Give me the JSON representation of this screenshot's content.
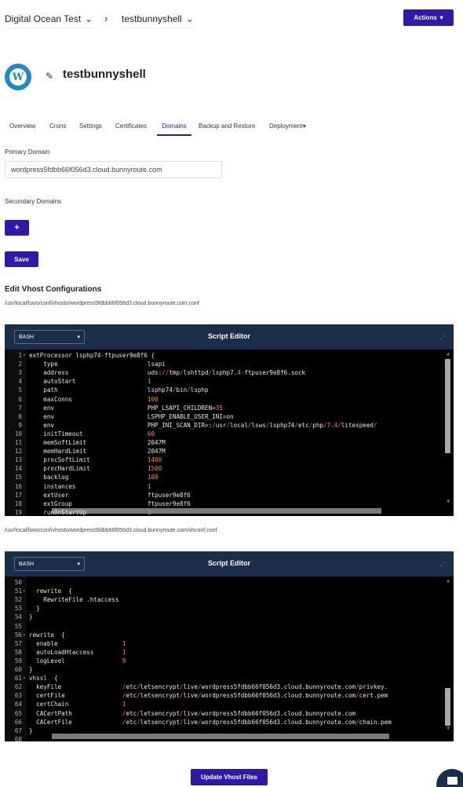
{
  "topbar": {
    "project": "Digital Ocean Test",
    "environment": "testbunnyshell",
    "separator": "›",
    "actions_label": "Actions"
  },
  "header": {
    "site_name": "testbunnyshell",
    "logo_letter": "W"
  },
  "tabs": [
    "Overview",
    "Crons",
    "Settings",
    "Certificates",
    "Domains",
    "Backup and Restore",
    "Deployment"
  ],
  "active_tab": "Domains",
  "domains": {
    "primary_label": "Primary Domain",
    "primary_value": "wordpress5fdbb66f056d3.cloud.bunnyroute.com",
    "secondary_label": "Secondary Domains",
    "add_label": "+",
    "save_label": "Save"
  },
  "vhost": {
    "title": "Edit Vhost Configurations",
    "path1": "/usr/local/lsws/conf/vhosts/wordpress5fdbb66f056d3.cloud.bunnyroute.com.conf",
    "path2": "/usr/local/lsws/conf/vhosts/wordpress5fdbb66f056d3.cloud.bunnyroute.com/vhconf.conf",
    "update_label": "Update Vhost Files"
  },
  "editor1": {
    "language": "BASH",
    "title": "Script Editor",
    "lines": [
      {
        "n": "1",
        "fold": true,
        "parts": [
          [
            "t",
            "extProcessor lsphp74-ftpuser9e8f6 {"
          ]
        ]
      },
      {
        "n": "2",
        "parts": [
          [
            "t",
            "    type                         lsapi"
          ]
        ]
      },
      {
        "n": "3",
        "parts": [
          [
            "t",
            "    address                      uds:"
          ],
          [
            "s",
            "//"
          ],
          [
            "t",
            "tmp"
          ],
          [
            "s",
            "/"
          ],
          [
            "t",
            "lshttpd"
          ],
          [
            "s",
            "/"
          ],
          [
            "t",
            "lsphp7."
          ],
          [
            "n",
            "4"
          ],
          [
            "s",
            "-"
          ],
          [
            "t",
            "ftpuser9e8f6.sock"
          ]
        ]
      },
      {
        "n": "4",
        "parts": [
          [
            "t",
            "    autoStart                    "
          ],
          [
            "n",
            "1"
          ]
        ]
      },
      {
        "n": "5",
        "parts": [
          [
            "t",
            "    path                         lsphp74"
          ],
          [
            "s",
            "/"
          ],
          [
            "t",
            "bin"
          ],
          [
            "s",
            "/"
          ],
          [
            "t",
            "lsphp"
          ]
        ]
      },
      {
        "n": "6",
        "parts": [
          [
            "t",
            "    maxConns                     "
          ],
          [
            "n",
            "100"
          ]
        ]
      },
      {
        "n": "7",
        "parts": [
          [
            "t",
            "    env                          PHP_LSAPI_CHILDREN="
          ],
          [
            "n",
            "35"
          ]
        ]
      },
      {
        "n": "8",
        "parts": [
          [
            "t",
            "    env                          LSPHP_ENABLE_USER_INI=on"
          ]
        ]
      },
      {
        "n": "9",
        "parts": [
          [
            "t",
            "    env                          PHP_INI_SCAN_DIR=:"
          ],
          [
            "s",
            "/"
          ],
          [
            "t",
            "usr"
          ],
          [
            "s",
            "/"
          ],
          [
            "t",
            "local"
          ],
          [
            "s",
            "/"
          ],
          [
            "t",
            "lsws"
          ],
          [
            "s",
            "/"
          ],
          [
            "t",
            "lsphp74"
          ],
          [
            "s",
            "/"
          ],
          [
            "t",
            "etc"
          ],
          [
            "s",
            "/"
          ],
          [
            "t",
            "php"
          ],
          [
            "s",
            "/"
          ],
          [
            "n",
            "7.4"
          ],
          [
            "s",
            "/"
          ],
          [
            "t",
            "litespeed"
          ],
          [
            "s",
            "/"
          ]
        ]
      },
      {
        "n": "10",
        "parts": [
          [
            "t",
            "    initTimeout                  "
          ],
          [
            "n",
            "60"
          ]
        ]
      },
      {
        "n": "11",
        "parts": [
          [
            "t",
            "    memSoftLimit                 2047M"
          ]
        ]
      },
      {
        "n": "12",
        "parts": [
          [
            "t",
            "    memHardLimit                 2047M"
          ]
        ]
      },
      {
        "n": "13",
        "parts": [
          [
            "t",
            "    procSoftLimit                "
          ],
          [
            "n",
            "1400"
          ]
        ]
      },
      {
        "n": "14",
        "parts": [
          [
            "t",
            "    procHardLimit                "
          ],
          [
            "n",
            "1500"
          ]
        ]
      },
      {
        "n": "15",
        "parts": [
          [
            "t",
            "    backlog                      "
          ],
          [
            "n",
            "100"
          ]
        ]
      },
      {
        "n": "16",
        "parts": [
          [
            "t",
            "    instances                    "
          ],
          [
            "n",
            "1"
          ]
        ]
      },
      {
        "n": "17",
        "parts": [
          [
            "t",
            "    extUser                      ftpuser9e8f6"
          ]
        ]
      },
      {
        "n": "18",
        "parts": [
          [
            "t",
            "    extGroup                     ftpuser9e8f6"
          ]
        ]
      },
      {
        "n": "19",
        "parts": [
          [
            "t",
            "    runOnStartUp                 "
          ],
          [
            "n",
            "3"
          ]
        ]
      }
    ]
  },
  "editor2": {
    "language": "BASH",
    "title": "Script Editor",
    "lines": [
      {
        "n": "50",
        "parts": [
          [
            "t",
            ""
          ]
        ]
      },
      {
        "n": "51",
        "fold": true,
        "parts": [
          [
            "t",
            "  rewrite  {"
          ]
        ]
      },
      {
        "n": "52",
        "parts": [
          [
            "t",
            "    RewriteFile .htaccess"
          ]
        ]
      },
      {
        "n": "53",
        "parts": [
          [
            "t",
            "  }"
          ]
        ]
      },
      {
        "n": "54",
        "parts": [
          [
            "t",
            "}"
          ]
        ]
      },
      {
        "n": "55",
        "parts": [
          [
            "t",
            ""
          ]
        ]
      },
      {
        "n": "56",
        "fold": true,
        "parts": [
          [
            "t",
            "rewrite  {"
          ]
        ]
      },
      {
        "n": "57",
        "parts": [
          [
            "t",
            "  enable                  "
          ],
          [
            "n",
            "1"
          ]
        ]
      },
      {
        "n": "58",
        "parts": [
          [
            "t",
            "  autoLoadHtaccess        "
          ],
          [
            "n",
            "1"
          ]
        ]
      },
      {
        "n": "59",
        "parts": [
          [
            "t",
            "  logLevel                "
          ],
          [
            "n",
            "9"
          ]
        ]
      },
      {
        "n": "60",
        "parts": [
          [
            "t",
            "}"
          ]
        ]
      },
      {
        "n": "61",
        "fold": true,
        "parts": [
          [
            "t",
            "vhssl  {"
          ]
        ]
      },
      {
        "n": "62",
        "parts": [
          [
            "t",
            "  keyFile                 "
          ],
          [
            "s",
            "/"
          ],
          [
            "t",
            "etc"
          ],
          [
            "s",
            "/"
          ],
          [
            "t",
            "letsencrypt"
          ],
          [
            "s",
            "/"
          ],
          [
            "t",
            "live"
          ],
          [
            "s",
            "/"
          ],
          [
            "t",
            "wordpress5fdbb66f056d3.cloud.bunnyroute.com"
          ],
          [
            "s",
            "/"
          ],
          [
            "t",
            "privkey."
          ]
        ]
      },
      {
        "n": "63",
        "parts": [
          [
            "t",
            "  certFile                "
          ],
          [
            "s",
            "/"
          ],
          [
            "t",
            "etc"
          ],
          [
            "s",
            "/"
          ],
          [
            "t",
            "letsencrypt"
          ],
          [
            "s",
            "/"
          ],
          [
            "t",
            "live"
          ],
          [
            "s",
            "/"
          ],
          [
            "t",
            "wordpress5fdbb66f056d3.cloud.bunnyroute.com"
          ],
          [
            "s",
            "/"
          ],
          [
            "t",
            "cert.pem"
          ]
        ]
      },
      {
        "n": "64",
        "parts": [
          [
            "t",
            "  certChain               "
          ],
          [
            "n",
            "1"
          ]
        ]
      },
      {
        "n": "65",
        "parts": [
          [
            "t",
            "  CACertPath              "
          ],
          [
            "s",
            "/"
          ],
          [
            "t",
            "etc"
          ],
          [
            "s",
            "/"
          ],
          [
            "t",
            "letsencrypt"
          ],
          [
            "s",
            "/"
          ],
          [
            "t",
            "live"
          ],
          [
            "s",
            "/"
          ],
          [
            "t",
            "wordpress5fdbb66f056d3.cloud.bunnyroute.com"
          ]
        ]
      },
      {
        "n": "66",
        "parts": [
          [
            "t",
            "  CACertFile              "
          ],
          [
            "s",
            "/"
          ],
          [
            "t",
            "etc"
          ],
          [
            "s",
            "/"
          ],
          [
            "t",
            "letsencrypt"
          ],
          [
            "s",
            "/"
          ],
          [
            "t",
            "live"
          ],
          [
            "s",
            "/"
          ],
          [
            "t",
            "wordpress5fdbb66f056d3.cloud.bunnyroute.com"
          ],
          [
            "s",
            "/"
          ],
          [
            "t",
            "chain.pem"
          ]
        ]
      },
      {
        "n": "67",
        "parts": [
          [
            "t",
            "}"
          ]
        ]
      },
      {
        "n": "68",
        "parts": [
          [
            "t",
            ""
          ]
        ]
      }
    ]
  },
  "colors": {
    "accent": "#2d1aa8",
    "editor_header": "#1a2d4a",
    "code_number": "#ff8a3d",
    "code_symbol": "#ff5c8a"
  }
}
